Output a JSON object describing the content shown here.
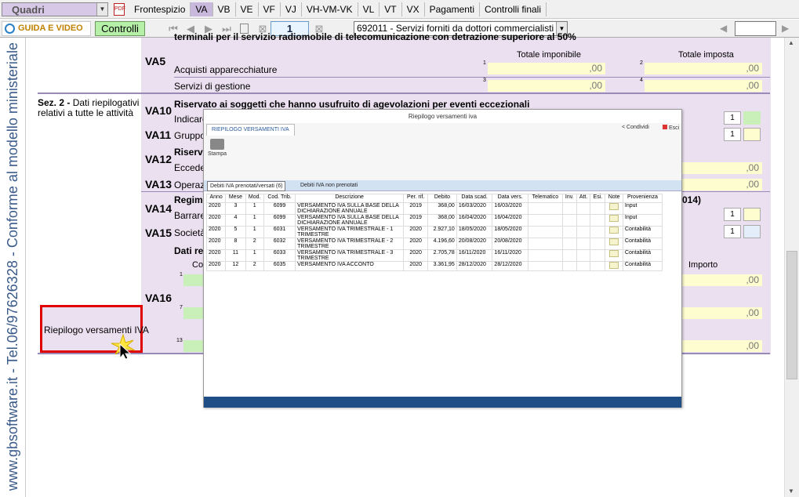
{
  "menubar": {
    "quadri_label": "Quadri",
    "tabs": [
      "Frontespizio",
      "VA",
      "VB",
      "VE",
      "VF",
      "VJ",
      "VH-VM-VK",
      "VL",
      "VT",
      "VX",
      "Pagamenti",
      "Controlli finali"
    ],
    "active_tab": "VA"
  },
  "toolbar": {
    "guida_label": "GUIDA E VIDEO",
    "controlli_label": "Controlli",
    "page_number": "1",
    "quadro_selected": "692011 - Servizi forniti da dottori commercialisti"
  },
  "side_strip": {
    "text": "www.gbsoftware.it - Tel.06/97626328 - Conforme al modello ministeriale"
  },
  "form": {
    "top_cut_text": "terminali per il servizio radiomobile di telecomunicazione con detrazione superiore al 50%",
    "col_totale_imponibile": "Totale imponibile",
    "col_totale_imposta": "Totale imposta",
    "va5": {
      "code": "VA5",
      "row1_label": "Acquisti apparecchiature",
      "row2_label": "Servizi di gestione",
      "n1": "1",
      "n2": "2",
      "n3": "3",
      "n4": "4",
      "value": ",00"
    },
    "sez2": {
      "title": "Sez. 2 -",
      "desc": "Dati riepilogativi relativi a tutte le attività"
    },
    "va10": {
      "code": "VA10",
      "title": "Riservato ai soggetti che hanno usufruito di agevolazioni per eventi eccezionali",
      "label": "Indicare",
      "box": "1"
    },
    "va11": {
      "code": "VA11",
      "label": "Gruppo",
      "box": "1"
    },
    "va12": {
      "code": "VA12",
      "label1": "Riserva",
      "label2": "Ecceder",
      "value": ",00"
    },
    "va13": {
      "code": "VA13",
      "label": "Operaz",
      "value": ",00"
    },
    "va14": {
      "code": "VA14",
      "label1": "Regime",
      "label2": "Barrare",
      "right_text": "014)",
      "box": "1"
    },
    "va15": {
      "code": "VA15",
      "label": "Società",
      "box": "1"
    },
    "va16": {
      "code": "VA16",
      "label": "Dati rel",
      "col_co": "Co",
      "col_importo": "Importo",
      "n1": "1",
      "n7": "7",
      "n13": "13",
      "value": ",00"
    }
  },
  "riepilogo_button": {
    "label": "Riepilogo versamenti IVA"
  },
  "dialog": {
    "title": "Riepilogo versamenti iva",
    "ribbon_tab": "RIEPILOGO VERSAMENTI IVA",
    "condividi": "Condividi",
    "esci": "Esci",
    "stampa": "Stampa",
    "subtabs": [
      "Debiti IVA prenotati/versati (6)",
      "Debiti IVA non prenotati"
    ],
    "columns": [
      "Anno",
      "Mese",
      "Mod.",
      "Cod. Trib.",
      "Descrizione",
      "Per. rif.",
      "Debito",
      "Data scad.",
      "Data vers.",
      "Telematico",
      "Inv.",
      "Att.",
      "Esi.",
      "Note",
      "Provenienza"
    ],
    "rows": [
      {
        "anno": "2020",
        "mese": "3",
        "mod": "1",
        "cod": "6099",
        "desc": "VERSAMENTO IVA SULLA BASE DELLA DICHIARAZIONE ANNUALE",
        "per": "2019",
        "debito": "368,00",
        "scad": "16/03/2020",
        "vers": "16/03/2020",
        "prov": "Input"
      },
      {
        "anno": "2020",
        "mese": "4",
        "mod": "1",
        "cod": "6099",
        "desc": "VERSAMENTO IVA SULLA BASE DELLA DICHIARAZIONE ANNUALE",
        "per": "2019",
        "debito": "368,00",
        "scad": "16/04/2020",
        "vers": "16/04/2020",
        "prov": "Input"
      },
      {
        "anno": "2020",
        "mese": "5",
        "mod": "1",
        "cod": "6031",
        "desc": "VERSAMENTO IVA TRIMESTRALE - 1 TRIMESTRE",
        "per": "2020",
        "debito": "2.927,10",
        "scad": "18/05/2020",
        "vers": "18/05/2020",
        "prov": "Contabilità"
      },
      {
        "anno": "2020",
        "mese": "8",
        "mod": "2",
        "cod": "6032",
        "desc": "VERSAMENTO IVA TRIMESTRALE - 2 TRIMESTRE",
        "per": "2020",
        "debito": "4.196,60",
        "scad": "20/08/2020",
        "vers": "20/08/2020",
        "prov": "Contabilità"
      },
      {
        "anno": "2020",
        "mese": "11",
        "mod": "1",
        "cod": "6033",
        "desc": "VERSAMENTO IVA TRIMESTRALE - 3 TRIMESTRE",
        "per": "2020",
        "debito": "2.705,78",
        "scad": "16/11/2020",
        "vers": "16/11/2020",
        "prov": "Contabilità"
      },
      {
        "anno": "2020",
        "mese": "12",
        "mod": "2",
        "cod": "6035",
        "desc": "VERSAMENTO IVA ACCONTO",
        "per": "2020",
        "debito": "3.361,95",
        "scad": "28/12/2020",
        "vers": "28/12/2020",
        "prov": "Contabilità"
      }
    ]
  },
  "colors": {
    "accent_purple": "#c8b8dc",
    "form_bg": "#ebe0f0",
    "highlight_red": "#e00000",
    "dialog_bar": "#1f4e87"
  }
}
